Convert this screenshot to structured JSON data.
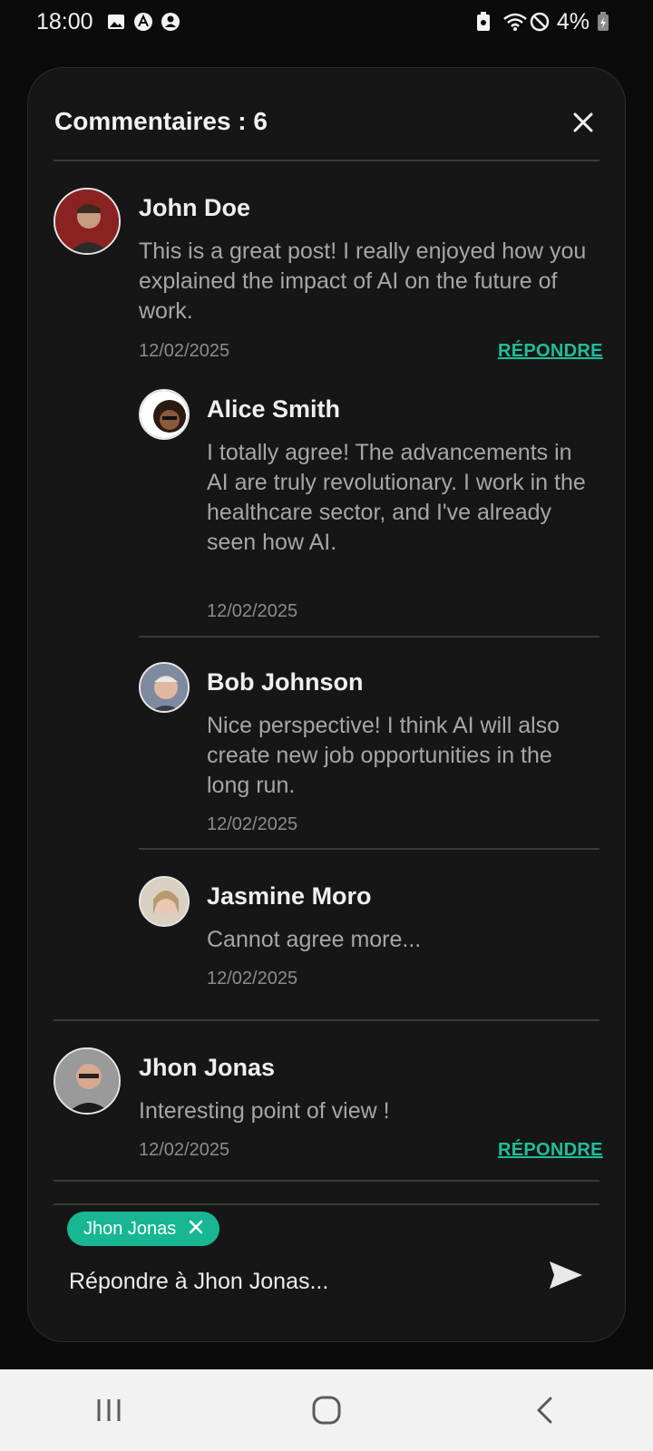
{
  "status_bar": {
    "time": "18:00",
    "battery": "4%",
    "icons": [
      "image-icon",
      "app-icon",
      "account-icon",
      "battery-saver-icon",
      "wifi-icon",
      "do-not-disturb-icon",
      "battery-charging-icon"
    ]
  },
  "sheet": {
    "title": "Commentaires : 6",
    "close_icon": "close-icon"
  },
  "comments": [
    {
      "name": "John Doe",
      "text": "This is a great post! I really enjoyed how you explained the impact of AI on the future of work.",
      "date": "12/02/2025",
      "reply_label": "RÉPONDRE",
      "avatar_color": "#7a1c1c",
      "replies": [
        {
          "name": "Alice Smith",
          "text": "I totally agree! The advancements in AI are truly revolutionary. I work in the healthcare sector, and I've already seen how AI.",
          "date": "12/02/2025",
          "avatar_color": "#4a3a2a"
        },
        {
          "name": "Bob Johnson",
          "text": "Nice perspective! I think AI will also create new job opportunities in the long run.",
          "date": "12/02/2025",
          "avatar_color": "#b89a86"
        },
        {
          "name": "Jasmine Moro",
          "text": "Cannot agree more...",
          "date": "12/02/2025",
          "avatar_color": "#c8b8a0"
        }
      ]
    },
    {
      "name": "Jhon Jonas",
      "text": "Interesting point of view !",
      "date": "12/02/2025",
      "reply_label": "RÉPONDRE",
      "avatar_color": "#6d6d6d"
    }
  ],
  "input": {
    "tag_label": "Jhon Jonas",
    "placeholder": "Répondre à Jhon Jonas...",
    "send_icon": "send-icon"
  },
  "colors": {
    "accent": "#1fbf9a",
    "chip": "#18b693",
    "sheet_bg": "#161616",
    "page_bg": "#0b0b0b"
  }
}
